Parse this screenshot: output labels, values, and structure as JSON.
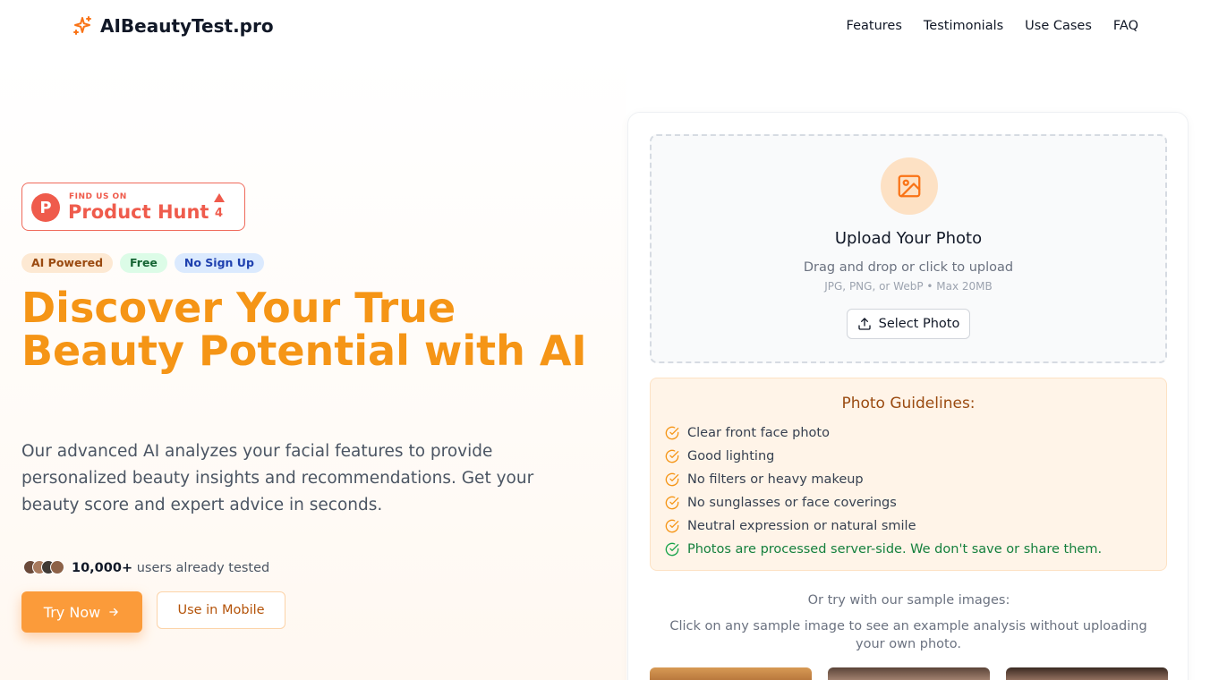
{
  "header": {
    "brand": "AIBeautyTest.pro",
    "nav": [
      "Features",
      "Testimonials",
      "Use Cases",
      "FAQ"
    ]
  },
  "hero": {
    "product_hunt": {
      "small": "FIND US ON",
      "big": "Product Hunt",
      "count": "4"
    },
    "tags": [
      "AI Powered",
      "Free",
      "No Sign Up"
    ],
    "title": "Discover Your True Beauty Potential with AI",
    "description": "Our advanced AI analyzes your facial features to provide personalized beauty insights and recommendations. Get your beauty score and expert advice in seconds.",
    "users_count": "10,000+",
    "users_text": "users already tested",
    "try_button": "Try Now",
    "mobile_button": "Use in Mobile"
  },
  "upload": {
    "title": "Upload Your Photo",
    "subtitle": "Drag and drop or click to upload",
    "hint": "JPG, PNG, or WebP • Max 20MB",
    "button": "Select Photo"
  },
  "guidelines": {
    "title": "Photo Guidelines:",
    "items": [
      "Clear front face photo",
      "Good lighting",
      "No filters or heavy makeup",
      "No sunglasses or face coverings",
      "Neutral expression or natural smile"
    ],
    "privacy": "Photos are processed server-side. We don't save or share them."
  },
  "samples": {
    "title": "Or try with our sample images:",
    "description": "Click on any sample image to see an example analysis without uploading your own photo."
  },
  "colors": {
    "accent": "#f59516",
    "button": "#fb9b3a",
    "product_hunt": "#ef5b4c"
  }
}
